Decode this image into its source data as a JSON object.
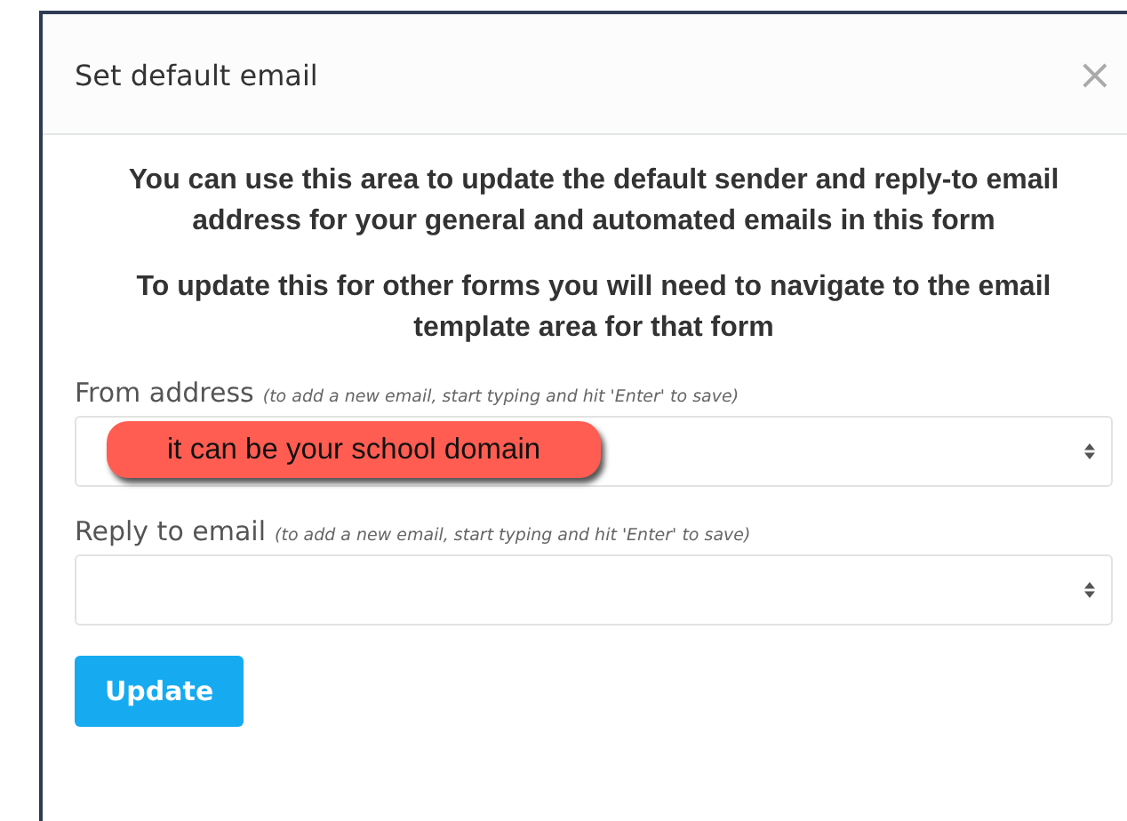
{
  "dialog": {
    "title": "Set default email",
    "close": "×",
    "paragraphs": [
      "You can use this area to update the default sender and reply-to email address for your general and automated emails in this form",
      "To update this for other forms you will need to navigate to the email template area for that form"
    ],
    "fields": [
      {
        "label": "From address",
        "hint": "(to add a new email, start typing and hit 'Enter' to save)",
        "callout": "it can be your school domain"
      },
      {
        "label": "Reply to email",
        "hint": "(to add a new email, start typing and hit 'Enter' to save)"
      }
    ],
    "button": "Update"
  }
}
